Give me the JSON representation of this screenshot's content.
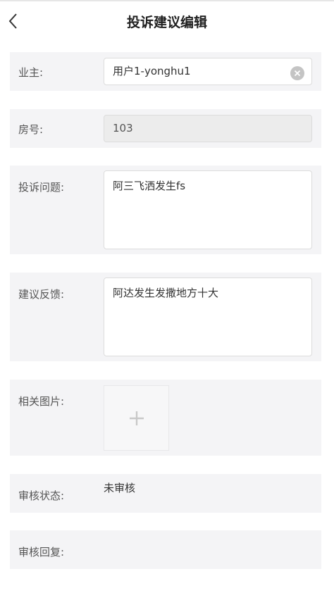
{
  "header": {
    "title": "投诉建议编辑"
  },
  "form": {
    "owner": {
      "label": "业主:",
      "value": "用户1-yonghu1"
    },
    "room": {
      "label": "房号:",
      "value": "103"
    },
    "complaint": {
      "label": "投诉问题:",
      "value": "阿三飞洒发生fs"
    },
    "suggestion": {
      "label": "建议反馈:",
      "value": "阿达发生发撒地方十大"
    },
    "images": {
      "label": "相关图片:"
    },
    "review_status": {
      "label": "审核状态:",
      "value": "未审核"
    },
    "review_reply": {
      "label": "审核回复:",
      "value": ""
    }
  },
  "icons": {
    "back": "chevron-left-icon",
    "clear": "clear-circle-icon",
    "add": "plus-icon"
  },
  "colors": {
    "row_background": "#f4f4f6",
    "disabled_field": "#ececec",
    "plus": "#c8c8c8"
  }
}
